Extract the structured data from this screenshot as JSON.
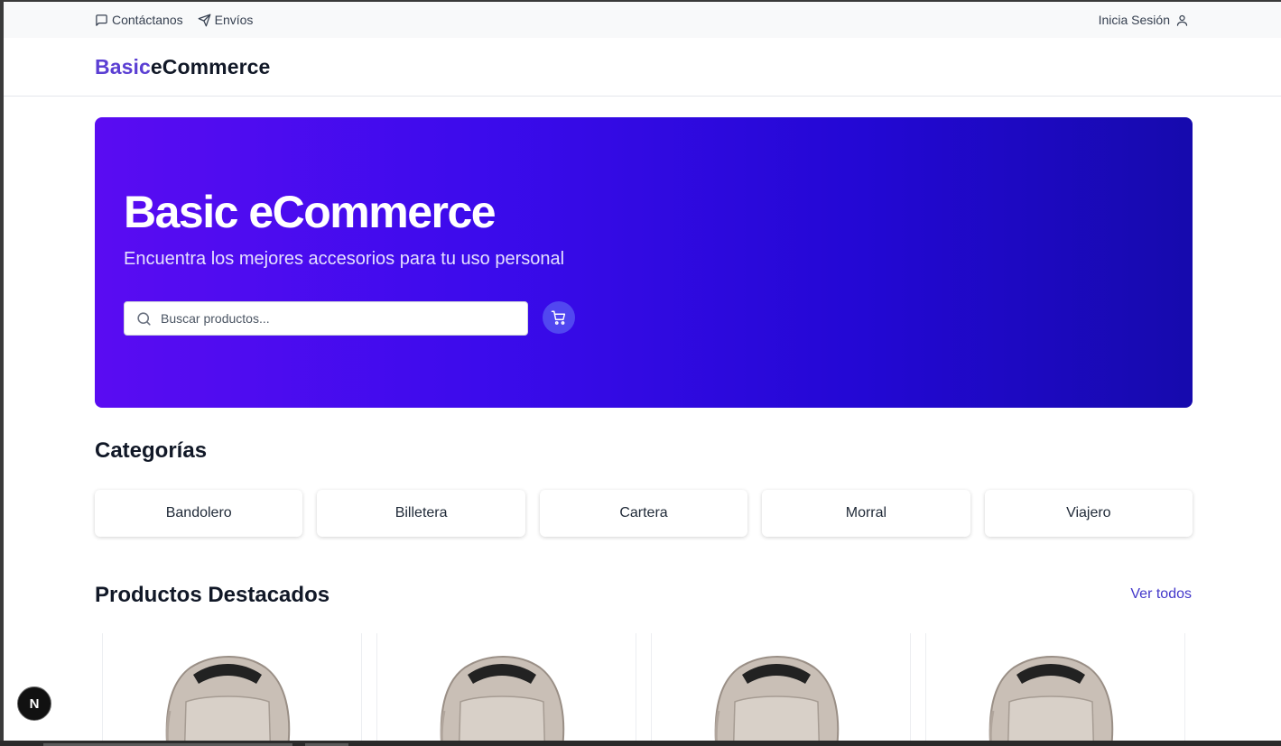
{
  "topbar": {
    "contact_label": "Contáctanos",
    "shipping_label": "Envíos",
    "login_label": "Inicia Sesión"
  },
  "header": {
    "logo_part1": "Basic",
    "logo_part2": "eCommerce"
  },
  "hero": {
    "title": "Basic eCommerce",
    "subtitle": "Encuentra los mejores accesorios para tu uso personal",
    "search_placeholder": "Buscar productos..."
  },
  "categories": {
    "title": "Categorías",
    "items": [
      "Bandolero",
      "Billetera",
      "Cartera",
      "Morral",
      "Viajero"
    ]
  },
  "featured": {
    "title": "Productos Destacados",
    "see_all": "Ver todos",
    "product_count_visible": 4
  },
  "dev_badge": "N",
  "colors": {
    "brand": "#5b3fd3",
    "hero_gradient_start": "#5a0cf2",
    "hero_gradient_end": "#160aad",
    "link": "#4338ca"
  }
}
